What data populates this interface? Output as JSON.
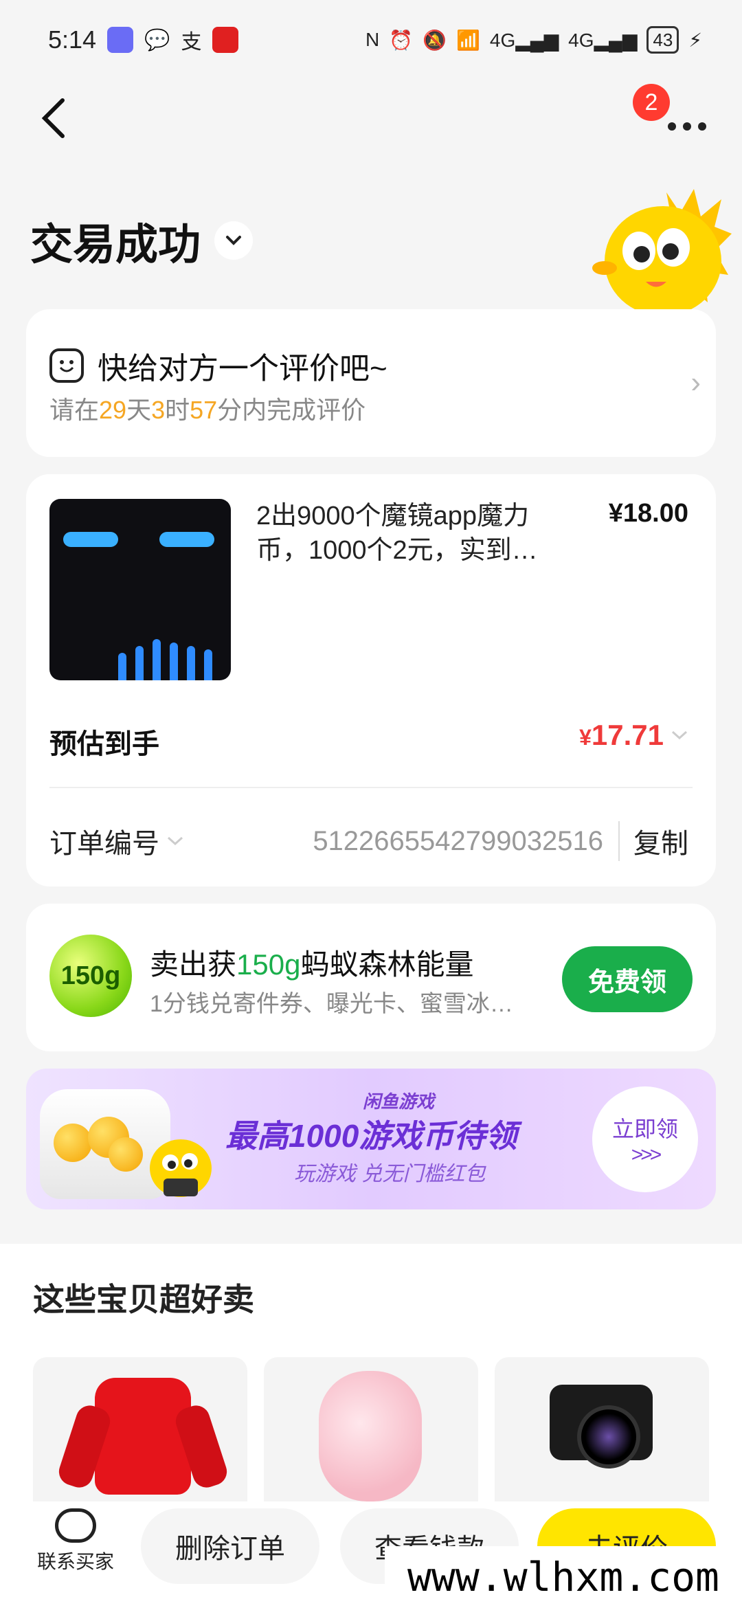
{
  "status": {
    "time": "5:14",
    "battery": "43"
  },
  "nav": {
    "badge_count": "2"
  },
  "page_title": "交易成功",
  "review": {
    "title": "快给对方一个评价吧~",
    "prefix": "请在",
    "days": "29",
    "days_unit": "天",
    "hours": "3",
    "hours_unit": "时",
    "minutes": "57",
    "suffix": "分内完成评价"
  },
  "order": {
    "product_title": "2出9000个魔镜app魔力币，1000个2元，实到…",
    "price": "¥18.00",
    "estimate_label": "预估到手",
    "estimate_currency": "¥",
    "estimate_value": "17.71",
    "order_no_label": "订单编号",
    "order_no": "5122665542799032516",
    "copy_label": "复制"
  },
  "energy": {
    "badge": "150g",
    "title_prefix": "卖出获",
    "title_highlight": "150g",
    "title_suffix": "蚂蚁森林能量",
    "subtitle": "1分钱兑寄件券、曝光卡、蜜雪冰…",
    "button": "免费领"
  },
  "banner": {
    "brand": "闲鱼游戏",
    "title": "最高1000游戏币待领",
    "subtitle": "玩游戏 兑无门槛红包",
    "cta": "立即领",
    "cta_arrows": ">>>"
  },
  "recommend": {
    "title": "这些宝贝超好卖"
  },
  "bottom": {
    "contact": "联系买家",
    "delete": "删除订单",
    "view_payment": "查看钱款",
    "review": "去评价"
  },
  "watermark": "www.wlhxm.com"
}
